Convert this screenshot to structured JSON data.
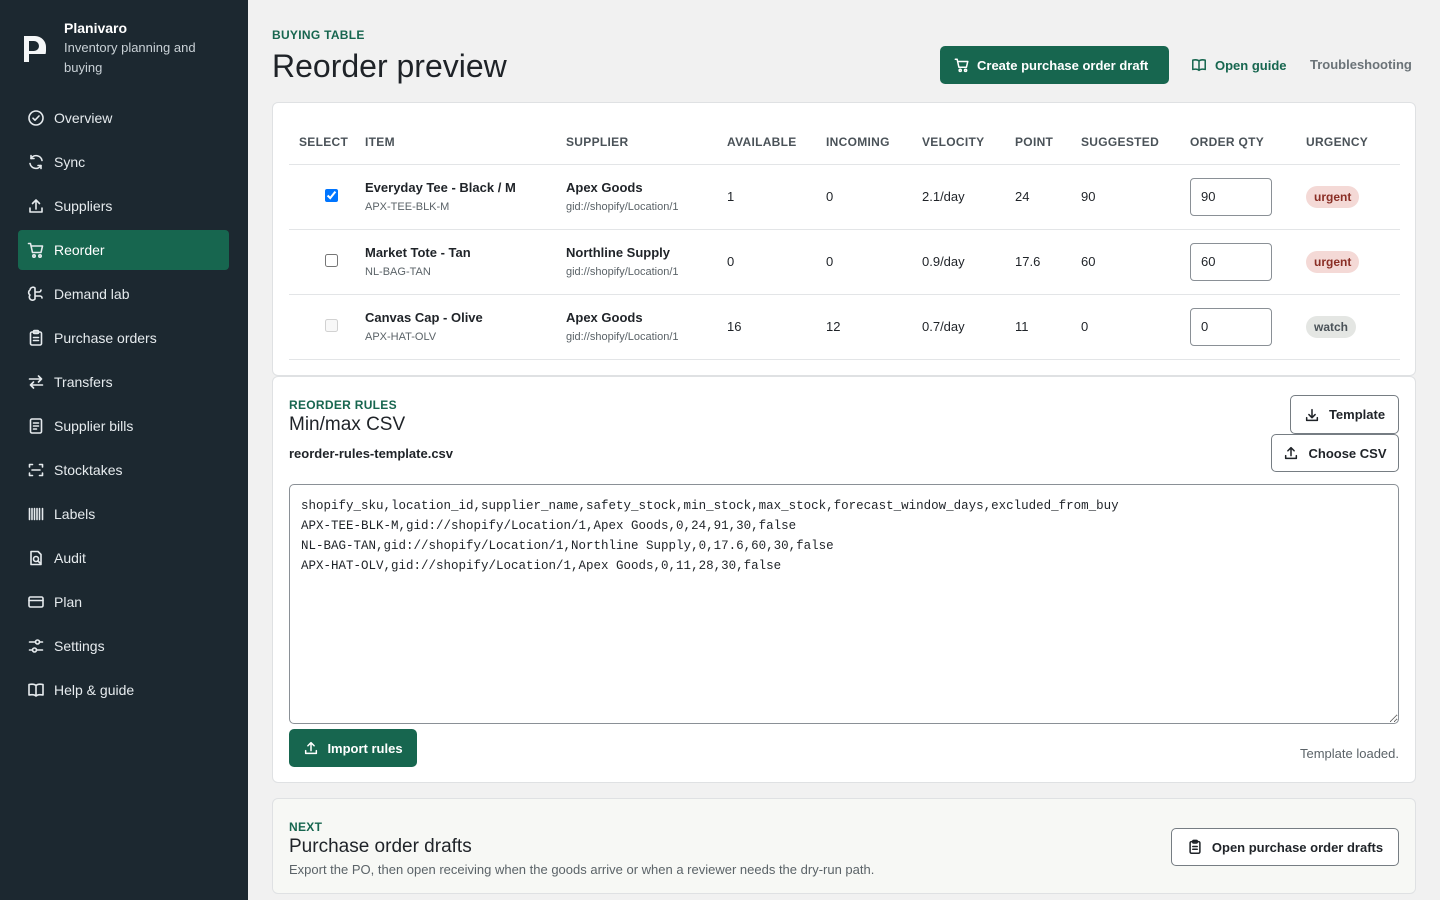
{
  "brand": {
    "name": "Planivaro",
    "subtitle": "Inventory planning and buying"
  },
  "nav": [
    {
      "label": "Overview",
      "icon": "check-circle-icon",
      "active": false
    },
    {
      "label": "Sync",
      "icon": "refresh-icon",
      "active": false
    },
    {
      "label": "Suppliers",
      "icon": "upload-icon",
      "active": false
    },
    {
      "label": "Reorder",
      "icon": "cart-icon",
      "active": true
    },
    {
      "label": "Demand lab",
      "icon": "brain-icon",
      "active": false
    },
    {
      "label": "Purchase orders",
      "icon": "clipboard-icon",
      "active": false
    },
    {
      "label": "Transfers",
      "icon": "arrows-icon",
      "active": false
    },
    {
      "label": "Supplier bills",
      "icon": "receipt-icon",
      "active": false
    },
    {
      "label": "Stocktakes",
      "icon": "scan-icon",
      "active": false
    },
    {
      "label": "Labels",
      "icon": "barcode-icon",
      "active": false
    },
    {
      "label": "Audit",
      "icon": "audit-icon",
      "active": false
    },
    {
      "label": "Plan",
      "icon": "card-icon",
      "active": false
    },
    {
      "label": "Settings",
      "icon": "sliders-icon",
      "active": false
    },
    {
      "label": "Help & guide",
      "icon": "book-icon",
      "active": false
    }
  ],
  "header": {
    "eyebrow": "BUYING TABLE",
    "title": "Reorder preview",
    "create_label": "Create purchase order draft",
    "guide_label": "Open guide",
    "troubleshoot_label": "Troubleshooting"
  },
  "table": {
    "columns": [
      "SELECT",
      "ITEM",
      "SUPPLIER",
      "AVAILABLE",
      "INCOMING",
      "VELOCITY",
      "POINT",
      "SUGGESTED",
      "ORDER QTY",
      "URGENCY"
    ],
    "rows": [
      {
        "checked": true,
        "disabled": false,
        "name": "Everyday Tee - Black / M",
        "sku": "APX-TEE-BLK-M",
        "supplier": "Apex Goods",
        "location": "gid://shopify/Location/1",
        "available": "1",
        "incoming": "0",
        "velocity": "2.1/day",
        "point": "24",
        "suggested": "90",
        "order_qty": "90",
        "urgency": "urgent"
      },
      {
        "checked": false,
        "disabled": false,
        "name": "Market Tote - Tan",
        "sku": "NL-BAG-TAN",
        "supplier": "Northline Supply",
        "location": "gid://shopify/Location/1",
        "available": "0",
        "incoming": "0",
        "velocity": "0.9/day",
        "point": "17.6",
        "suggested": "60",
        "order_qty": "60",
        "urgency": "urgent"
      },
      {
        "checked": false,
        "disabled": true,
        "name": "Canvas Cap - Olive",
        "sku": "APX-HAT-OLV",
        "supplier": "Apex Goods",
        "location": "gid://shopify/Location/1",
        "available": "16",
        "incoming": "12",
        "velocity": "0.7/day",
        "point": "11",
        "suggested": "0",
        "order_qty": "0",
        "urgency": "watch"
      }
    ]
  },
  "rules": {
    "eyebrow": "REORDER RULES",
    "title": "Min/max CSV",
    "filename": "reorder-rules-template.csv",
    "template_label": "Template",
    "choose_label": "Choose CSV",
    "csv_text": "shopify_sku,location_id,supplier_name,safety_stock,min_stock,max_stock,forecast_window_days,excluded_from_buy\nAPX-TEE-BLK-M,gid://shopify/Location/1,Apex Goods,0,24,91,30,false\nNL-BAG-TAN,gid://shopify/Location/1,Northline Supply,0,17.6,60,30,false\nAPX-HAT-OLV,gid://shopify/Location/1,Apex Goods,0,11,28,30,false",
    "import_label": "Import rules",
    "status": "Template loaded."
  },
  "next": {
    "eyebrow": "NEXT",
    "title": "Purchase order drafts",
    "description": "Export the PO, then open receiving when the goods arrive or when a reviewer needs the dry-run path.",
    "button_label": "Open purchase order drafts"
  },
  "colors": {
    "accent": "#17664f",
    "sidebar": "#1c2830",
    "urgent_bg": "#f4d9d6",
    "urgent_text": "#8a2e25"
  }
}
